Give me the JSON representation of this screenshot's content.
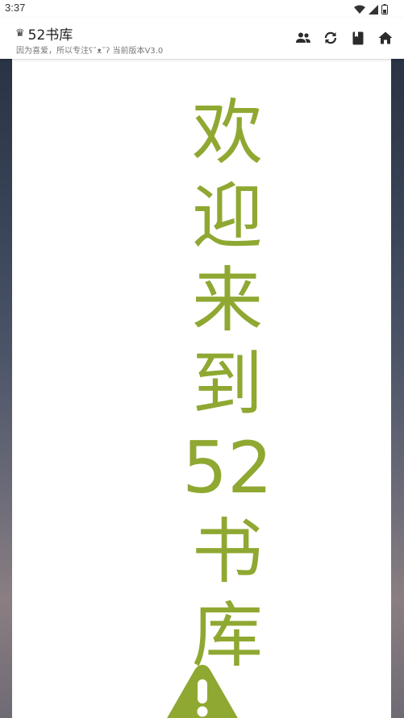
{
  "status_bar": {
    "time": "3:37",
    "icons": [
      "wifi-icon",
      "signal-icon",
      "battery-icon"
    ]
  },
  "app_bar": {
    "crown_icon": "♛",
    "title": "52书库",
    "subtitle": "因为喜爱，所以专注ʕ˘ᴥ˘ʔ 当前版本V3.0",
    "actions": [
      "people-icon",
      "sync-icon",
      "book-icon",
      "home-icon"
    ]
  },
  "welcome": {
    "chars": [
      "欢",
      "迎",
      "来",
      "到",
      "52",
      "书",
      "库"
    ]
  },
  "colors": {
    "accent": "#8fa832",
    "app_bar_bg": "#ffffff",
    "icon_color": "#2b2b2b"
  }
}
